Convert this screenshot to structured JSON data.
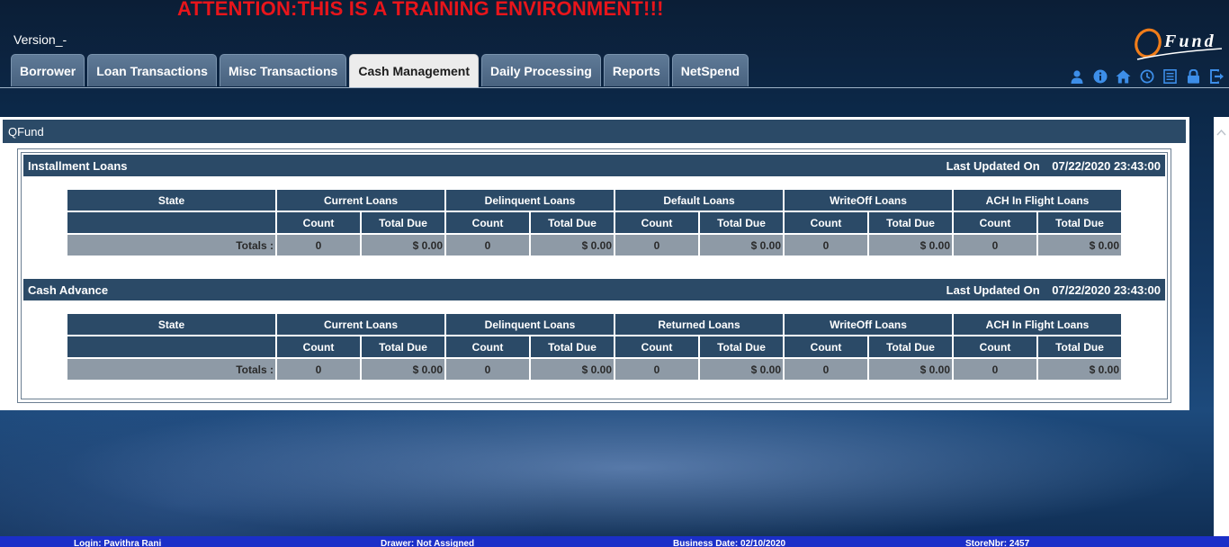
{
  "banner": "ATTENTION:THIS IS A TRAINING ENVIRONMENT!!!",
  "version_label": "Version_-",
  "logo_text": "Fund",
  "tabs": [
    {
      "label": "Borrower"
    },
    {
      "label": "Loan Transactions"
    },
    {
      "label": "Misc Transactions"
    },
    {
      "label": "Cash Management",
      "active": true
    },
    {
      "label": "Daily Processing"
    },
    {
      "label": "Reports"
    },
    {
      "label": "NetSpend"
    }
  ],
  "toolbar_icons": [
    "user-icon",
    "info-icon",
    "home-icon",
    "clock-icon",
    "document-icon",
    "lock-icon",
    "logout-icon"
  ],
  "panel_title": "QFund",
  "installment": {
    "title": "Installment Loans",
    "updated_label": "Last Updated On",
    "updated_value": "07/22/2020 23:43:00",
    "state_header": "State",
    "groups": [
      "Current Loans",
      "Delinquent Loans",
      "Default Loans",
      "WriteOff Loans",
      "ACH In Flight Loans"
    ],
    "count_label": "Count",
    "due_label": "Total Due",
    "totals_label": "Totals :",
    "totals": [
      {
        "count": "0",
        "due": "$ 0.00"
      },
      {
        "count": "0",
        "due": "$ 0.00"
      },
      {
        "count": "0",
        "due": "$ 0.00"
      },
      {
        "count": "0",
        "due": "$ 0.00"
      },
      {
        "count": "0",
        "due": "$ 0.00"
      }
    ]
  },
  "cash_advance": {
    "title": "Cash Advance",
    "updated_label": "Last Updated On",
    "updated_value": "07/22/2020 23:43:00",
    "state_header": "State",
    "groups": [
      "Current Loans",
      "Delinquent Loans",
      "Returned Loans",
      "WriteOff Loans",
      "ACH In Flight Loans"
    ],
    "count_label": "Count",
    "due_label": "Total Due",
    "totals_label": "Totals :",
    "totals": [
      {
        "count": "0",
        "due": "$ 0.00"
      },
      {
        "count": "0",
        "due": "$ 0.00"
      },
      {
        "count": "0",
        "due": "$ 0.00"
      },
      {
        "count": "0",
        "due": "$ 0.00"
      },
      {
        "count": "0",
        "due": "$ 0.00"
      }
    ]
  },
  "status": {
    "login": "Login: Pavithra Rani",
    "drawer": "Drawer: Not Assigned",
    "business_date": "Business Date: 02/10/2020",
    "store": "StoreNbr: 2457"
  },
  "colors": {
    "banner": "#e8151b",
    "header_bar": "#2b4a67",
    "totals_row": "#8e9aa6",
    "status_bar": "#1b2fc8"
  }
}
